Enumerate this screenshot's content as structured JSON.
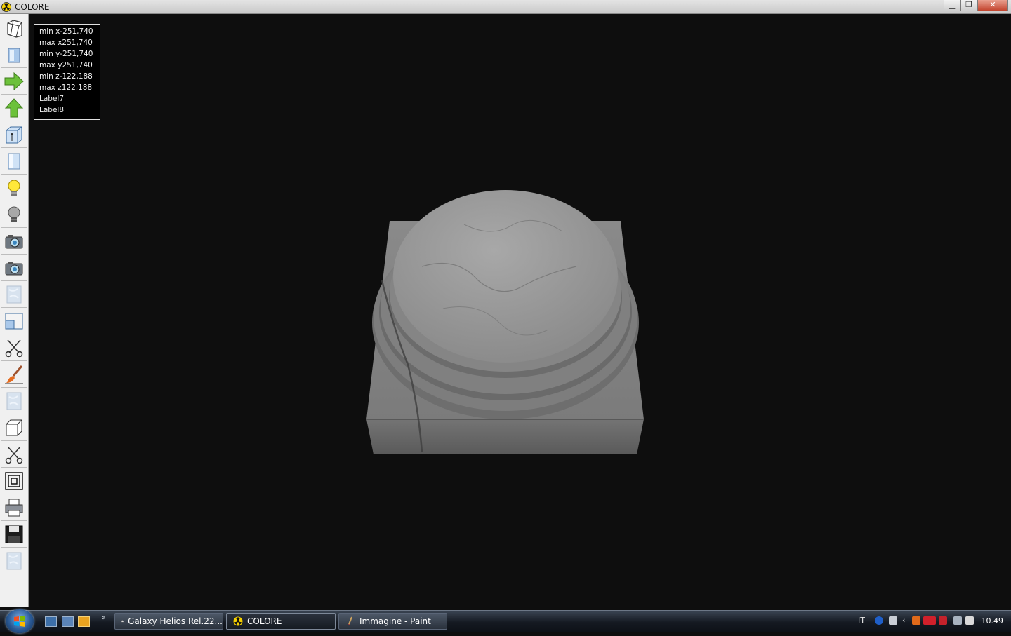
{
  "window": {
    "title": "COLORE",
    "minimize": "▁",
    "restore": "❐",
    "close": "✕"
  },
  "toolbar": {
    "tools": [
      "wireframe-icon",
      "shaded-box-icon",
      "arrow-right-icon",
      "arrow-up-icon",
      "box-axis-icon",
      "cylinder-icon",
      "light-on-icon",
      "light-off-icon",
      "camera-icon",
      "camera-alt-icon",
      "texture-icon",
      "window-split-icon",
      "scissors-icon",
      "brush-icon",
      "texture-alt-icon",
      "cube-icon",
      "scissors-alt-icon",
      "layers-icon",
      "printer-icon",
      "floppy-save-icon",
      "texture-light-icon"
    ]
  },
  "info": {
    "lines": [
      "min x-251,740",
      "max x251,740",
      "min y-251,740",
      "max y251,740",
      "min z-122,188",
      "max z122,188",
      "Label7",
      "Label8"
    ]
  },
  "taskbar": {
    "more": "»",
    "tasks": [
      {
        "label": "Galaxy Helios  Rel.22...",
        "icon": "explorer-icon"
      },
      {
        "label": "COLORE",
        "icon": "colore-app-icon"
      },
      {
        "label": "Immagine - Paint",
        "icon": "paint-icon"
      }
    ],
    "language": "IT",
    "clock": "10.49"
  },
  "colors": {
    "viewport_bg": "#0e0e0e",
    "marble": "#8f8f8f",
    "accent_green": "#6cc13a"
  }
}
